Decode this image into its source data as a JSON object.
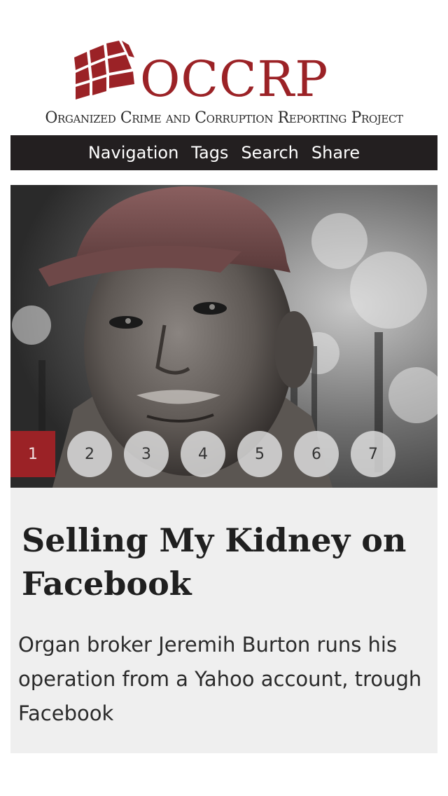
{
  "header": {
    "logo_word": "OCCRP",
    "tagline": "Organized Crime and Corruption Reporting Project",
    "brand_color": "#9b2226"
  },
  "nav": {
    "items": [
      {
        "label": "Navigation"
      },
      {
        "label": "Tags"
      },
      {
        "label": "Search"
      },
      {
        "label": "Share"
      }
    ]
  },
  "slider": {
    "active_page": 1,
    "pages": [
      "1",
      "2",
      "3",
      "4",
      "5",
      "6",
      "7"
    ]
  },
  "article": {
    "title": "Selling My Kidney on Facebook",
    "description": "Organ broker Jeremih Burton runs his operation from a Yahoo account, trough Facebook"
  }
}
